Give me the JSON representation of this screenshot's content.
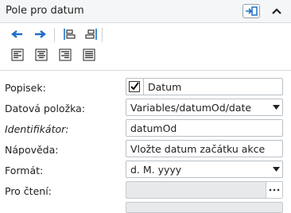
{
  "panel": {
    "title": "Pole pro datum"
  },
  "header_icons": {
    "dock": "dock-panel-icon",
    "collapse": "chevron-up-icon"
  },
  "toolbar": {
    "buttons": [
      "arrow-left-icon",
      "arrow-right-icon",
      "align-left-edge-icon",
      "align-right-edge-icon",
      "text-align-left-icon",
      "text-align-center-icon",
      "text-align-right-icon",
      "text-align-justify-icon"
    ]
  },
  "colors": {
    "accent_blue": "#1d6fc4",
    "border": "#b9c0c7",
    "disabled": "#e7e9eb"
  },
  "fields": {
    "popisek": {
      "label": "Popisek:",
      "value": "Datum",
      "checked": true
    },
    "datova_polozka": {
      "label": "Datová položka:",
      "value": "Variables/datumOd/date"
    },
    "identifikator": {
      "label": "Identifikátor:",
      "value": "datumOd"
    },
    "napoveda": {
      "label": "Nápověda:",
      "value": "Vložte datum začátku akce"
    },
    "format": {
      "label": "Formát:",
      "value": "d. M. yyyy"
    },
    "pro_cteni": {
      "label": "Pro čtení:",
      "value": ""
    }
  }
}
